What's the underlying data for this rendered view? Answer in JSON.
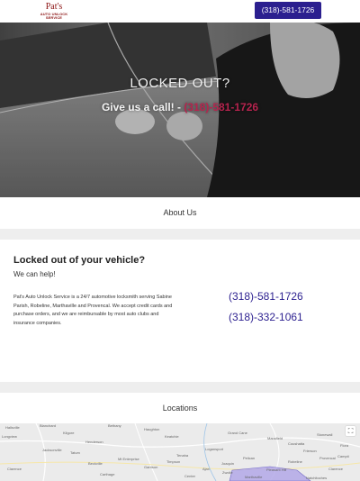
{
  "header": {
    "logo_main": "Pat's",
    "logo_sub": "AUTO UNLOCK SERVICE",
    "call_button": "(318)-581-1726"
  },
  "hero": {
    "title": "LOCKED OUT?",
    "subtitle_prefix": "Give us a call! - ",
    "subtitle_phone": "(318)-581-1726"
  },
  "about": {
    "title": "About Us"
  },
  "info": {
    "heading": "Locked out of your vehicle?",
    "subheading": "We can help!",
    "body": "Pat's Auto Unlock Service is a 24/7 automotive locksmith serving Sabine Parish, Robeline, Marthaville and Provencal. We accept credit cards and purchase orders, and we are reimbursable by most auto clubs and insurance companies.",
    "phone_primary": "(318)-581-1726",
    "phone_secondary": "(318)-332-1061"
  },
  "locations": {
    "title": "Locations"
  },
  "map": {
    "labels": [
      "Blanchard",
      "Haughton",
      "Grand Cane",
      "Mansfield",
      "Coushatta",
      "Keatchie",
      "Logansport",
      "Stonewall",
      "Jacksonville",
      "Mt Enterprise",
      "Garrison",
      "Timpson",
      "Center",
      "Carthage",
      "Pleasant Hill",
      "Clarence",
      "Marthaville",
      "Natchitoches",
      "Tenaha",
      "Joaquin",
      "Bethany",
      "Frierson",
      "Hallsville",
      "Longview",
      "Kilgore",
      "Henderson",
      "Tatum",
      "Beckville",
      "Pelican",
      "Zwolle",
      "Ajax",
      "Robeline",
      "Provencal",
      "Flora",
      "Campti",
      "Clarence"
    ],
    "region_color": "#b3a9e8",
    "fullscreen_icon": "fullscreen-icon"
  },
  "colors": {
    "brand": "#2b1f8f",
    "logo": "#8b1212",
    "hero_phone": "#b6244e"
  }
}
